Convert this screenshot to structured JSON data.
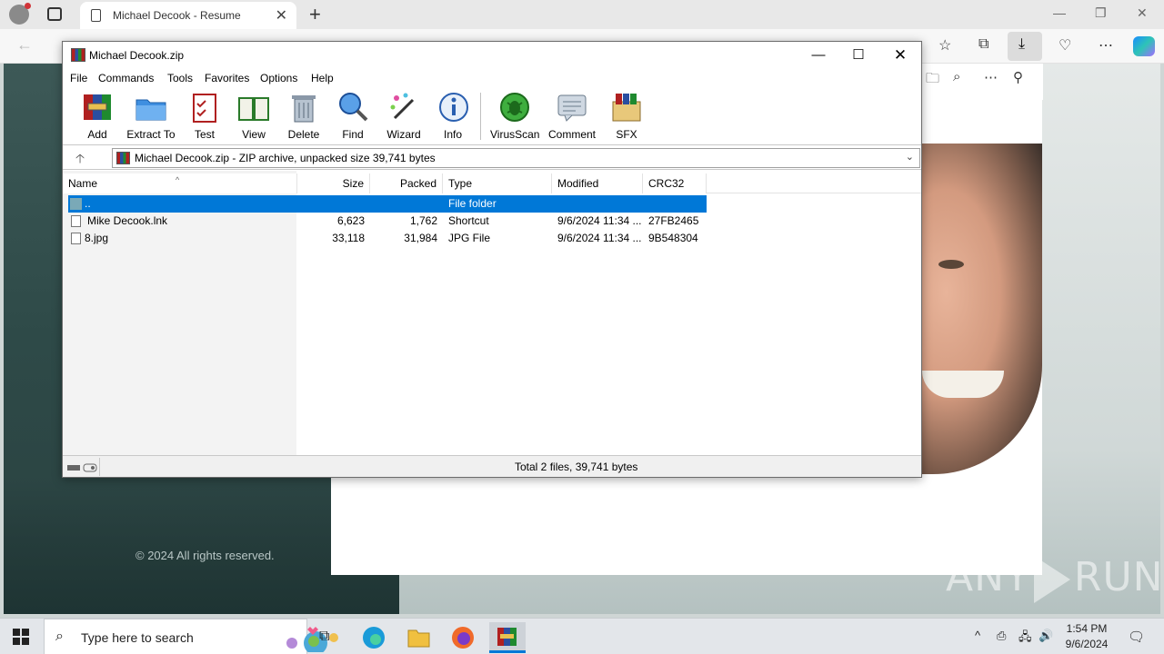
{
  "browser": {
    "tab_title": "Michael Decook - Resume",
    "tab_close": "✕",
    "new_tab": "+",
    "window_controls": [
      "—",
      "❐",
      "✕"
    ]
  },
  "page": {
    "copyright": "© 2024 All rights reserved."
  },
  "watermark": {
    "left": "ANY",
    "right": "RUN"
  },
  "winrar": {
    "title": "Michael Decook.zip",
    "controls": {
      "minimize": "—",
      "maximize": "☐",
      "close": "✕"
    },
    "menu": [
      "File",
      "Commands",
      "Tools",
      "Favorites",
      "Options",
      "Help"
    ],
    "toolbar": [
      {
        "label": "Add",
        "icon": "add-archive-icon"
      },
      {
        "label": "Extract To",
        "icon": "extract-folder-icon"
      },
      {
        "label": "Test",
        "icon": "test-checklist-icon"
      },
      {
        "label": "View",
        "icon": "view-book-icon"
      },
      {
        "label": "Delete",
        "icon": "trash-bin-icon"
      },
      {
        "label": "Find",
        "icon": "magnifier-icon"
      },
      {
        "label": "Wizard",
        "icon": "magic-wand-icon"
      },
      {
        "label": "Info",
        "icon": "info-icon"
      },
      {
        "label": "VirusScan",
        "icon": "virus-bug-icon"
      },
      {
        "label": "Comment",
        "icon": "comment-bubble-icon"
      },
      {
        "label": "SFX",
        "icon": "sfx-box-icon"
      }
    ],
    "address": "Michael Decook.zip - ZIP archive, unpacked size 39,741 bytes",
    "columns": [
      "Name",
      "Size",
      "Packed",
      "Type",
      "Modified",
      "CRC32"
    ],
    "rows": [
      {
        "name": "..",
        "size": "",
        "packed": "",
        "type": "File folder",
        "modified": "",
        "crc": ""
      },
      {
        "name": "Mike Decook.lnk",
        "size": "6,623",
        "packed": "1,762",
        "type": "Shortcut",
        "modified": "9/6/2024 11:34 ...",
        "crc": "27FB2465"
      },
      {
        "name": "8.jpg",
        "size": "33,118",
        "packed": "31,984",
        "type": "JPG File",
        "modified": "9/6/2024 11:34 ...",
        "crc": "9B548304"
      }
    ],
    "status": "Total 2 files, 39,741 bytes"
  },
  "taskbar": {
    "search_placeholder": "Type here to search",
    "time": "1:54 PM",
    "date": "9/6/2024"
  },
  "colors": {
    "selection": "#0078d7",
    "winrar_red": "#b02020",
    "page_dark": "#2e4a48"
  }
}
